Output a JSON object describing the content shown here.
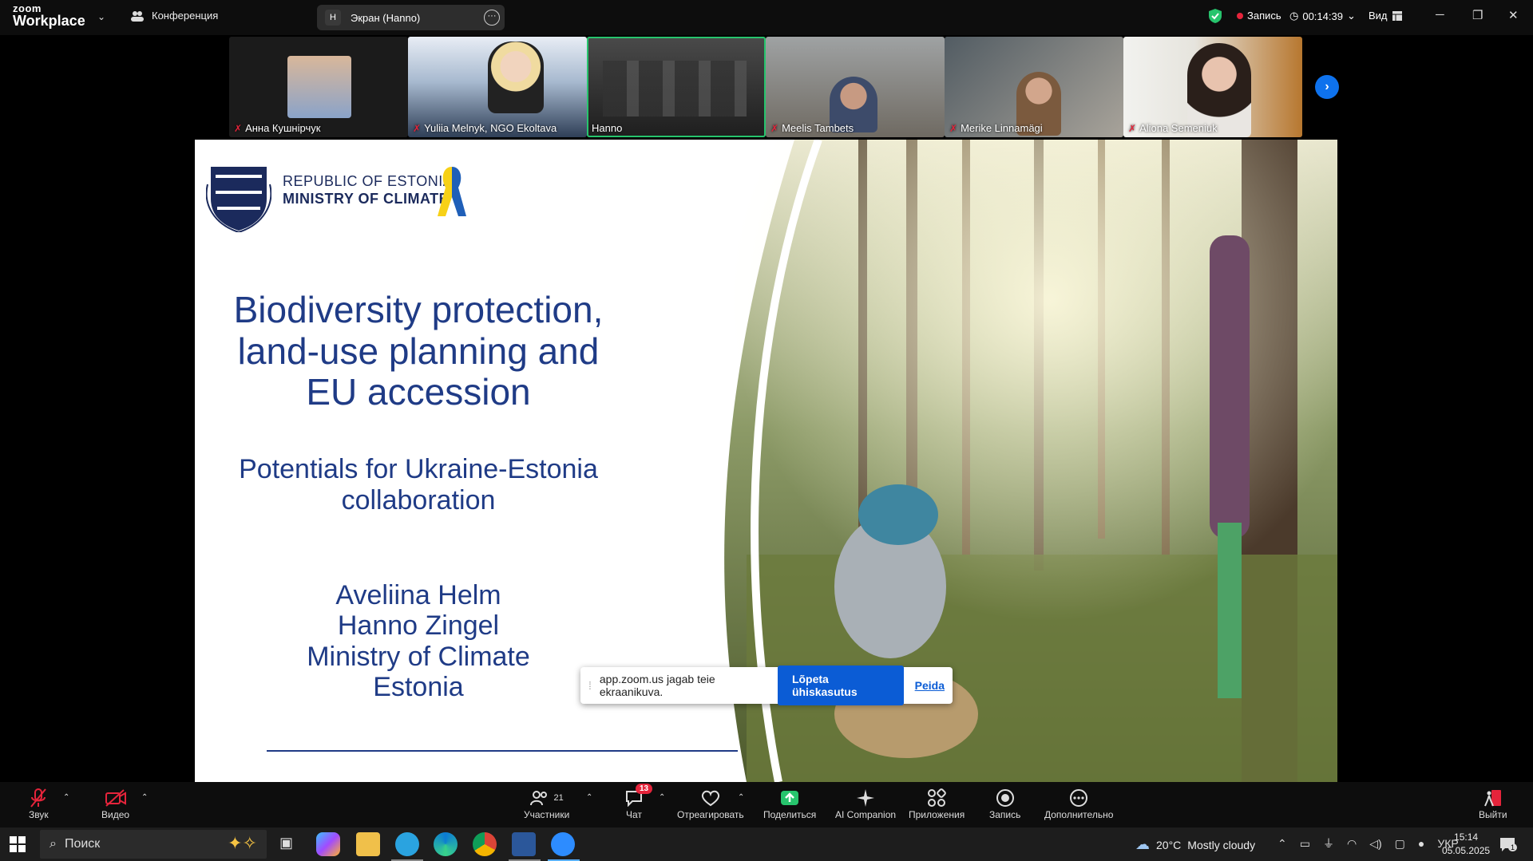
{
  "titlebar": {
    "brand_top": "zoom",
    "brand_bottom": "Workplace",
    "conference_label": "Конференция",
    "screen_tab_initial": "Н",
    "screen_tab_label": "Экран (Hanno)",
    "recording_label": "Запись",
    "timer": "00:14:39",
    "view_label": "Вид"
  },
  "participants": [
    {
      "name": "Анна Кушнірчук",
      "muted": true
    },
    {
      "name": "Yuliia Melnyk, NGO Ekoltava",
      "muted": true
    },
    {
      "name": "Hanno",
      "muted": false,
      "active": true
    },
    {
      "name": "Meelis Tambets",
      "muted": true
    },
    {
      "name": "Merike Linnamägi",
      "muted": true
    },
    {
      "name": "Aliona Semeniuk",
      "muted": true
    }
  ],
  "slide": {
    "org_line1": "REPUBLIC OF ESTONIA",
    "org_line2": "MINISTRY OF CLIMATE",
    "title_lines": [
      "Biodiversity protection,",
      "land-use planning and",
      "EU accession"
    ],
    "subtitle_lines": [
      "Potentials for Ukraine-Estonia",
      "collaboration"
    ],
    "author_lines": [
      "Aveliina Helm",
      "Hanno Zingel",
      "Ministry of Climate",
      "Estonia"
    ]
  },
  "share_banner": {
    "message": "app.zoom.us jagab teie ekraanikuva.",
    "stop_label": "Lõpeta ühiskasutus",
    "hide_label": "Peida"
  },
  "toolbar": {
    "audio": "Звук",
    "video": "Видео",
    "participants": "Участники",
    "participants_count": "21",
    "chat": "Чат",
    "chat_badge": "13",
    "react": "Отреагировать",
    "share": "Поделиться",
    "ai": "AI Companion",
    "apps": "Приложения",
    "record": "Запись",
    "more": "Дополнительно",
    "leave": "Выйти"
  },
  "taskbar": {
    "search_placeholder": "Поиск",
    "weather_temp": "20°C",
    "weather_desc": "Mostly cloudy",
    "language": "УКР",
    "time": "15:14",
    "date": "05.05.2025",
    "notification_count": "1"
  },
  "colors": {
    "accent": "#0e72ed",
    "slide_text": "#1f3b86",
    "record_red": "#e5243b",
    "active_green": "#27c46d"
  }
}
